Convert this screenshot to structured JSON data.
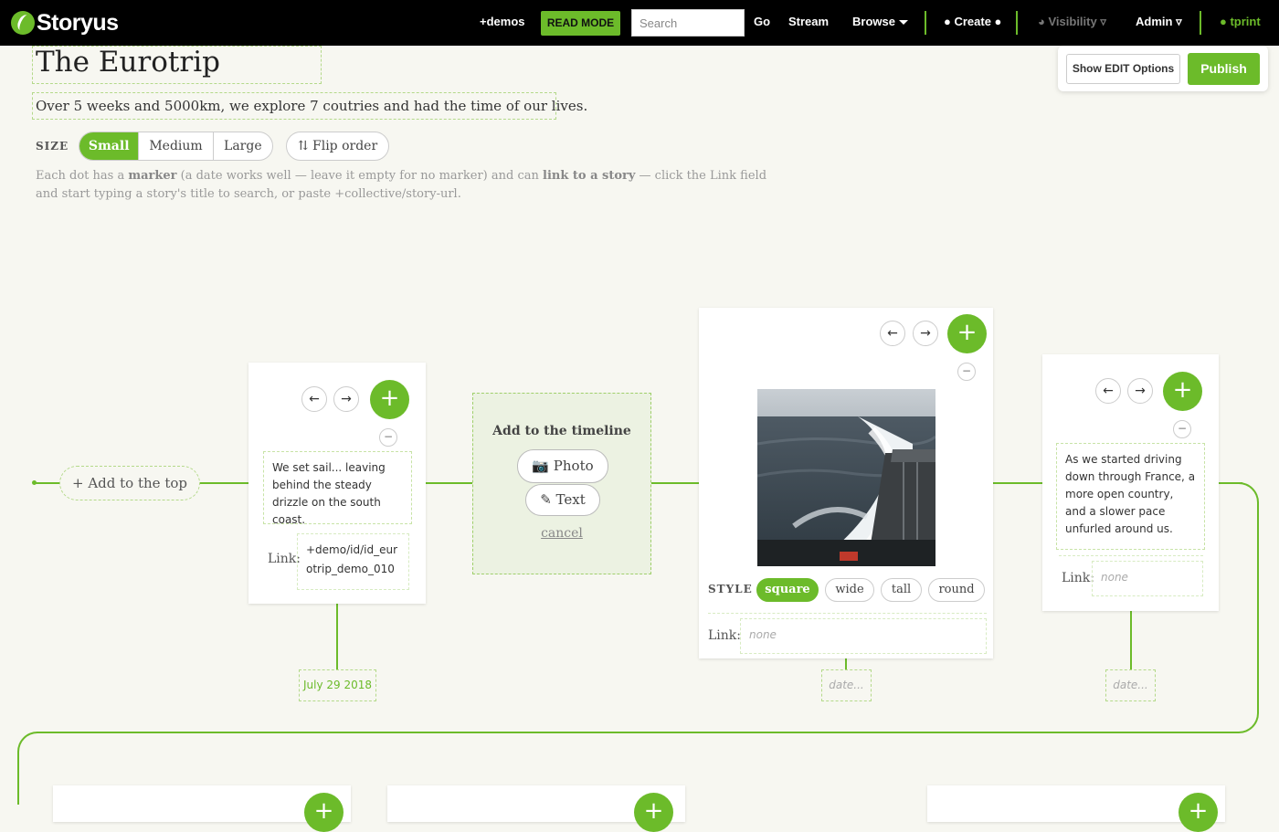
{
  "nav": {
    "logo_text": "Storyus",
    "demos": "+demos",
    "read_mode": "READ MODE",
    "search_placeholder": "Search",
    "go": "Go",
    "stream": "Stream",
    "browse": "Browse",
    "create": "Create",
    "visibility": "Visibility",
    "admin": "Admin",
    "user": "tprint"
  },
  "story": {
    "title": "The Eurotrip",
    "subtitle": "Over 5 weeks and 5000km, we explore 7 coutries and had the time of our lives."
  },
  "size": {
    "label": "SIZE",
    "options": [
      "Small",
      "Medium",
      "Large"
    ],
    "selected": "Small",
    "flip_order": "Flip order"
  },
  "help": {
    "part1": "Each dot has a ",
    "marker": "marker",
    "part2": " (a date works well — leave it empty for no marker) and can ",
    "link": "link to a story",
    "part3": " — click the Link field and start typing a story's title to search, or paste +collective/story-url."
  },
  "edit_options": {
    "show_edit": "Show EDIT Options",
    "publish": "Publish"
  },
  "timeline": {
    "add_to_top": "+ Add to the top",
    "add_panel": {
      "title": "Add to the timeline",
      "photo": "📷 Photo",
      "text": "✎ Text",
      "cancel": "cancel"
    },
    "link_label": "Link:",
    "none_placeholder": "none",
    "date_placeholder": "date...",
    "cards": [
      {
        "text": "We set sail... leaving behind the steady drizzle on the south coast.",
        "link": "+demo/id/id_eurotrip_demo_010",
        "date": "July 29 2018"
      },
      {
        "type": "photo",
        "style_label": "STYLE",
        "styles": [
          "square",
          "wide",
          "tall",
          "round"
        ],
        "selected_style": "square",
        "link": "none",
        "date": "date..."
      },
      {
        "text": "As we started driving down through France, a more open country, and a slower pace unfurled around us.",
        "link": "none",
        "date": "date..."
      }
    ]
  },
  "colors": {
    "accent": "#6cbb2a",
    "nav_bg": "#000000",
    "page_bg": "#f7f7f1"
  }
}
